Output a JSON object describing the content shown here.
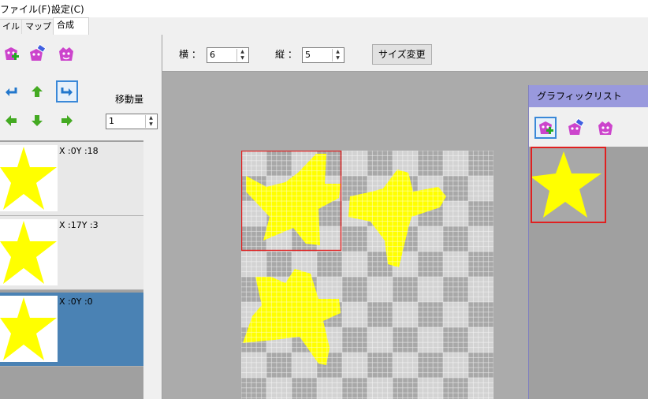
{
  "menubar": {
    "file": "ファイル(F)",
    "settings": "設定(C)"
  },
  "tabs": [
    {
      "label": "イル"
    },
    {
      "label": "マップ"
    },
    {
      "label": "合成"
    }
  ],
  "left_panel": {
    "move_label": "移動量",
    "move_value": "1"
  },
  "layers": [
    {
      "coord": "X :0Y :18"
    },
    {
      "coord": "X :17Y :3"
    },
    {
      "coord": "X :0Y :0"
    }
  ],
  "toolbar": {
    "width_label": "横 ：",
    "width_value": "6",
    "height_label": "縦 ：",
    "height_value": "5",
    "resize_button": "サイズ変更"
  },
  "graphic_list": {
    "title": "グラフィックリスト"
  },
  "colors": {
    "star": "#ffff00",
    "grid_light": "#d3d3d3",
    "grid_dark": "#a8a8a8",
    "selection": "#e02020",
    "selected_layer": "#4a82b4"
  },
  "icons": [
    "add-graphic-icon",
    "erase-graphic-icon",
    "graphic-settings-icon",
    "rotate-left-icon",
    "up-arrow-icon",
    "rotate-right-icon",
    "left-arrow-icon",
    "down-arrow-icon",
    "right-arrow-icon"
  ]
}
